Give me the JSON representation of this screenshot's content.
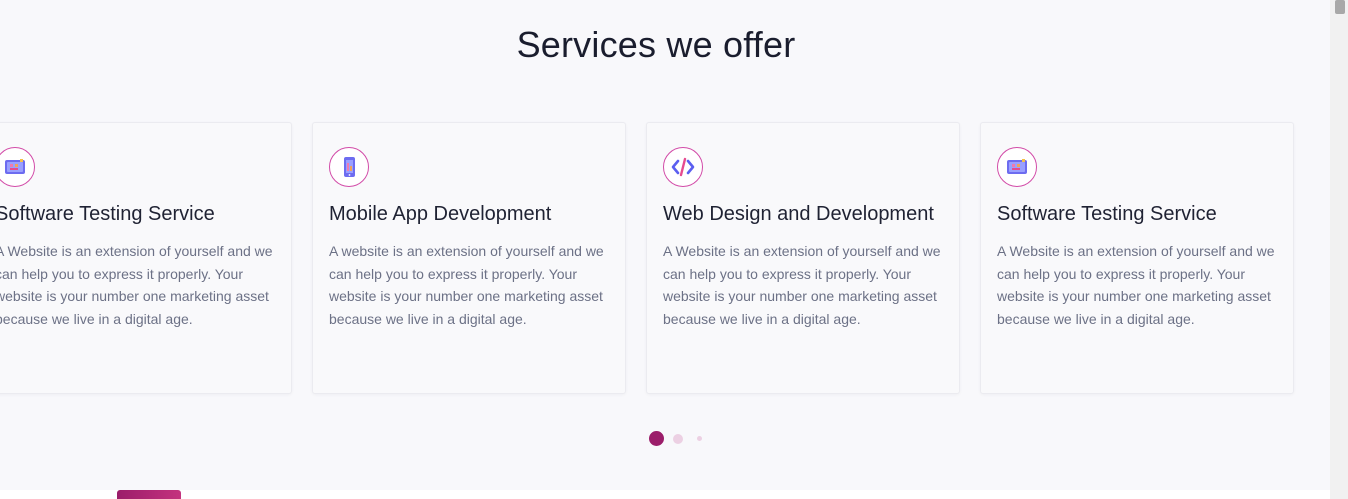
{
  "section": {
    "title": "Services we offer"
  },
  "cards": [
    {
      "icon": "software-testing-icon",
      "title": "Software Testing Service",
      "description": "A Website is an extension of yourself and we can help you to express it properly. Your website is your number one marketing asset because we live in a digital age."
    },
    {
      "icon": "mobile-app-icon",
      "title": "Mobile App Development",
      "description": "A website is an extension of yourself and we can help you to express it properly. Your website is your number one marketing asset because we live in a digital age."
    },
    {
      "icon": "code-icon",
      "title": "Web Design and Development",
      "description": "A Website is an extension of yourself and we can help you to express it properly. Your website is your number one marketing asset because we live in a digital age."
    },
    {
      "icon": "software-testing-icon",
      "title": "Software Testing Service",
      "description": "A Website is an extension of yourself and we can help you to express it properly. Your website is your number one marketing asset because we live in a digital age."
    }
  ],
  "carousel": {
    "active_index": 0,
    "dot_count": 3
  },
  "colors": {
    "accent": "#9b1d6a",
    "icon_border": "#d24ba8",
    "icon_fill": "#6d6cf0",
    "title_text": "#1a1d2e",
    "body_text": "#6c7186"
  }
}
